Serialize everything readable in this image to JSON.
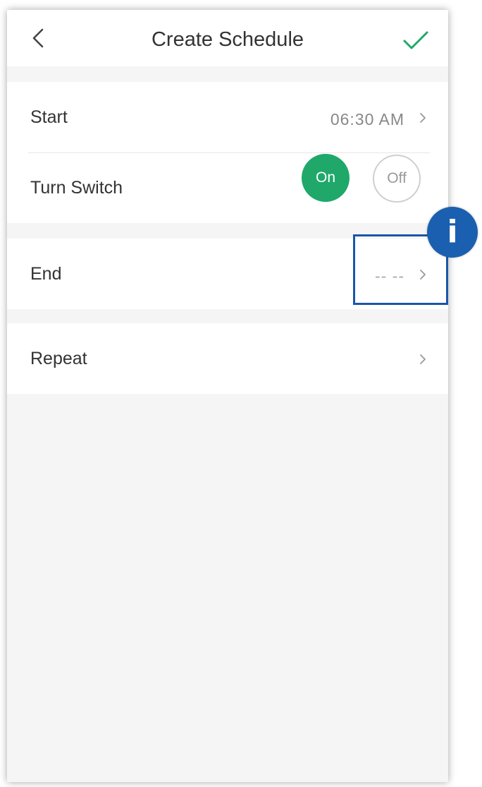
{
  "header": {
    "title": "Create Schedule",
    "back_icon": "chevron-left-icon",
    "confirm_icon": "checkmark-icon"
  },
  "rows": {
    "start": {
      "label": "Start",
      "value": "06:30 AM"
    },
    "turn_switch": {
      "label": "Turn Switch",
      "on_label": "On",
      "off_label": "Off",
      "selected": "On"
    },
    "end": {
      "label": "End",
      "value": "-- --"
    },
    "repeat": {
      "label": "Repeat"
    }
  },
  "info_badge": {
    "label": "i"
  },
  "colors": {
    "accent_green": "#1fa86a",
    "highlight_blue": "#1b56a8",
    "background": "#f5f5f5"
  }
}
